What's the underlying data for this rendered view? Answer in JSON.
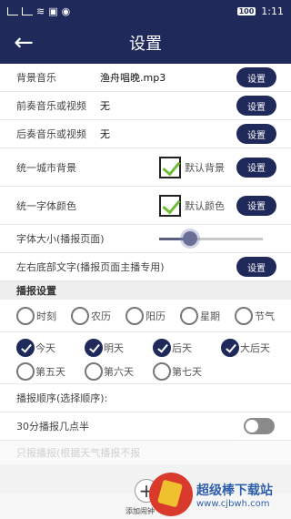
{
  "status": {
    "time": "1:11",
    "battery": "100"
  },
  "header": {
    "title": "设置"
  },
  "rows": {
    "bgmusic": {
      "label": "背景音乐",
      "value": "渔舟唱晚.mp3",
      "button": "设置"
    },
    "pre": {
      "label": "前奏音乐或视频",
      "value": "无",
      "button": "设置"
    },
    "post": {
      "label": "后奏音乐或视频",
      "value": "无",
      "button": "设置"
    },
    "citybg": {
      "label": "统一城市背景",
      "check": "默认背景",
      "button": "设置"
    },
    "fontcolor": {
      "label": "统一字体颜色",
      "check": "默认颜色",
      "button": "设置"
    },
    "fontsize": {
      "label": "字体大小(播报页面)",
      "level": 0.3
    },
    "cornertext": {
      "label": "左右底部文字(播报页面主播专用)",
      "button": "设置"
    }
  },
  "broadcast": {
    "section": "播报设置",
    "types": [
      "时刻",
      "农历",
      "阳历",
      "星期",
      "节气"
    ],
    "days_row1": [
      "今天",
      "明天",
      "后天",
      "大后天"
    ],
    "days_row2": [
      "第五天",
      "第六天",
      "第七天"
    ],
    "order_label": "播报顺序(选择顺序):",
    "halfhour_label": "30分播报几点半",
    "faded_label": "只报播报(根据天气播报不报"
  },
  "bottom": {
    "add_label": "添加闹钟"
  },
  "watermark": {
    "title": "超级棒下载站",
    "url": "www.cjbwh.com"
  }
}
